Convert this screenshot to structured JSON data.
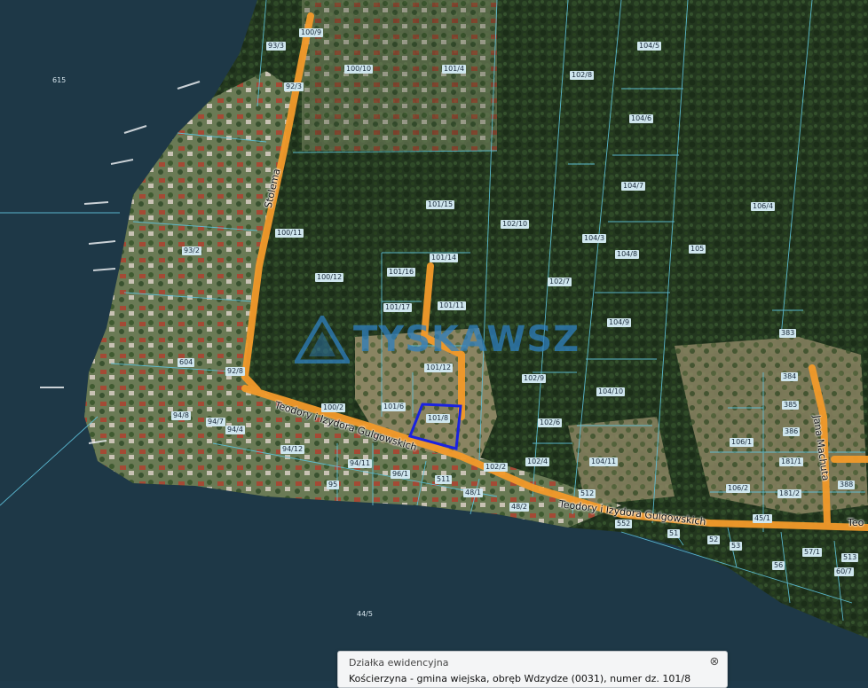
{
  "map": {
    "parcels": [
      {
        "id": "615",
        "kind": "water"
      },
      {
        "id": "44/5",
        "kind": "water"
      },
      {
        "id": "100/9"
      },
      {
        "id": "93/3"
      },
      {
        "id": "92/3"
      },
      {
        "id": "100/10"
      },
      {
        "id": "101/4"
      },
      {
        "id": "102/8"
      },
      {
        "id": "104/5"
      },
      {
        "id": "104/6"
      },
      {
        "id": "104/7"
      },
      {
        "id": "106/4"
      },
      {
        "id": "101/15"
      },
      {
        "id": "102/10"
      },
      {
        "id": "100/11"
      },
      {
        "id": "93/2"
      },
      {
        "id": "100/12"
      },
      {
        "id": "101/16"
      },
      {
        "id": "101/14"
      },
      {
        "id": "101/17"
      },
      {
        "id": "101/11"
      },
      {
        "id": "104/3"
      },
      {
        "id": "104/8"
      },
      {
        "id": "105"
      },
      {
        "id": "102/7"
      },
      {
        "id": "104/9"
      },
      {
        "id": "383"
      },
      {
        "id": "101/12"
      },
      {
        "id": "92/8"
      },
      {
        "id": "604"
      },
      {
        "id": "102/9"
      },
      {
        "id": "384"
      },
      {
        "id": "104/10"
      },
      {
        "id": "100/2"
      },
      {
        "id": "101/6"
      },
      {
        "id": "101/8"
      },
      {
        "id": "385"
      },
      {
        "id": "94/8"
      },
      {
        "id": "94/7"
      },
      {
        "id": "94/4"
      },
      {
        "id": "102/6"
      },
      {
        "id": "386"
      },
      {
        "id": "106/1"
      },
      {
        "id": "94/12"
      },
      {
        "id": "94/11"
      },
      {
        "id": "102/4"
      },
      {
        "id": "104/11"
      },
      {
        "id": "181/1"
      },
      {
        "id": "96/1"
      },
      {
        "id": "102/2"
      },
      {
        "id": "106/2"
      },
      {
        "id": "181/2"
      },
      {
        "id": "388"
      },
      {
        "id": "95"
      },
      {
        "id": "48/1"
      },
      {
        "id": "48/2"
      },
      {
        "id": "45/1"
      },
      {
        "id": "552"
      },
      {
        "id": "51"
      },
      {
        "id": "52"
      },
      {
        "id": "53"
      },
      {
        "id": "57/1"
      },
      {
        "id": "56"
      },
      {
        "id": "60/7"
      },
      {
        "id": "511"
      },
      {
        "id": "512"
      },
      {
        "id": "513"
      }
    ],
    "streets": [
      {
        "name": "Stolema"
      },
      {
        "name": "Teodory i Izydora Gulgowskich"
      },
      {
        "name": "Teodory i Izydora Gulgowskich"
      },
      {
        "name": "Jana Machuta"
      },
      {
        "name": "Teo"
      }
    ],
    "selected_parcel": "101/8"
  },
  "watermark": {
    "text": "TYSKAWSZ"
  },
  "popup": {
    "title": "Działka ewidencyjna",
    "body": "Kościerzyna - gmina wiejska, obręb Wdzydze (0031), numer dz. 101/8"
  }
}
